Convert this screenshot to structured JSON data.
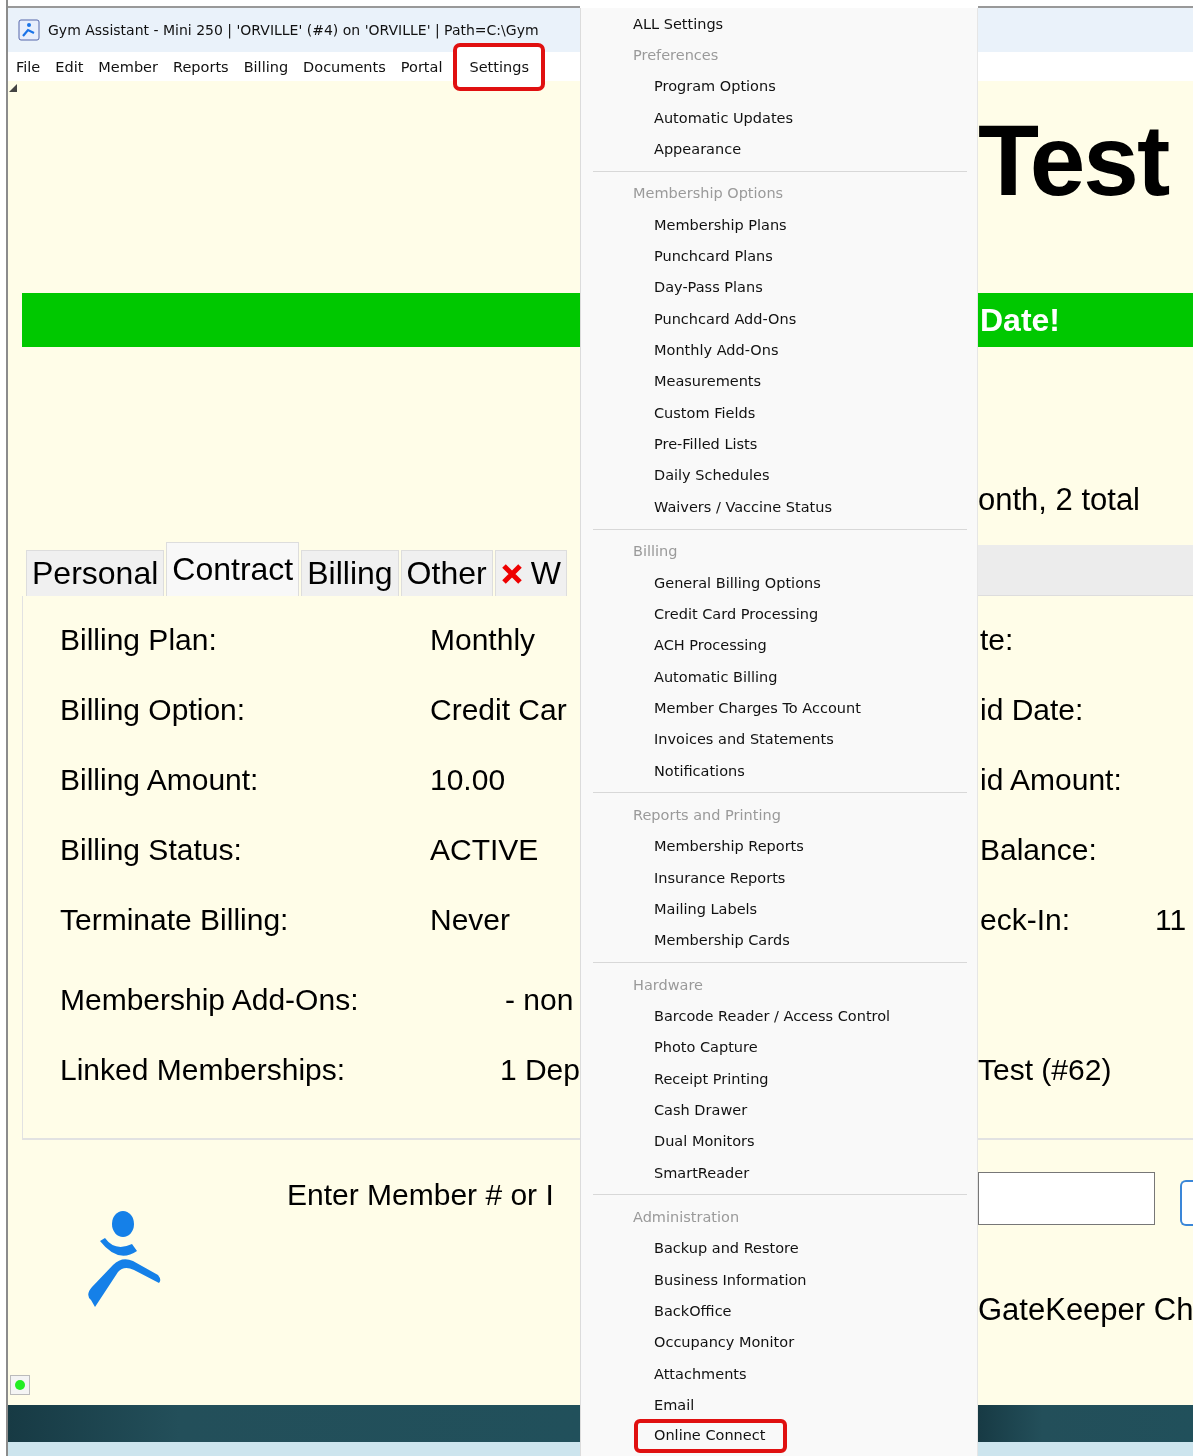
{
  "window": {
    "title": "Gym Assistant - Mini 250 | 'ORVILLE' (#4) on 'ORVILLE' | Path=C:\\Gym"
  },
  "menubar": [
    {
      "label": "File",
      "highlighted": false
    },
    {
      "label": "Edit",
      "highlighted": false
    },
    {
      "label": "Member",
      "highlighted": false
    },
    {
      "label": "Reports",
      "highlighted": false
    },
    {
      "label": "Billing",
      "highlighted": false
    },
    {
      "label": "Documents",
      "highlighted": false
    },
    {
      "label": "Portal",
      "highlighted": false
    },
    {
      "label": "Settings",
      "highlighted": true
    }
  ],
  "header": {
    "name": "Test",
    "banner": "Date!",
    "visits": "onth, 2 total"
  },
  "tabs": [
    {
      "label": "Personal",
      "selected": false,
      "kind": "plain"
    },
    {
      "label": "Contract",
      "selected": true,
      "kind": "plain"
    },
    {
      "label": "Billing",
      "selected": false,
      "kind": "plain"
    },
    {
      "label": "Other",
      "selected": false,
      "kind": "plain"
    },
    {
      "label": "W",
      "selected": false,
      "kind": "flagged"
    }
  ],
  "contract": {
    "rows": [
      {
        "kind": "field",
        "label": "Billing Plan:",
        "value": "Monthly",
        "right_label": "te:"
      },
      {
        "kind": "field",
        "label": "Billing Option:",
        "value": "Credit Car",
        "right_label": "id Date:"
      },
      {
        "kind": "field",
        "label": "Billing Amount:",
        "value": "10.00",
        "right_label": "id Amount:"
      },
      {
        "kind": "field",
        "label": "Billing Status:",
        "value": "ACTIVE",
        "right_label": "Balance:"
      },
      {
        "kind": "field",
        "label": "Terminate Billing:",
        "value": "Never",
        "right_label": "eck-In:",
        "right_value": "11"
      },
      {
        "kind": "wide",
        "label": "Membership Add-Ons:",
        "value": "- non"
      },
      {
        "kind": "wide",
        "label": "Linked Memberships:",
        "value": "1 Dep",
        "right_value": "Test (#62)"
      }
    ]
  },
  "lookup": {
    "prompt": "Enter Member # or I",
    "gatekeeper": "GateKeeper Ch"
  },
  "settings_menu": {
    "entries": [
      {
        "kind": "top",
        "label": "ALL Settings",
        "highlighted": false
      },
      {
        "kind": "header",
        "label": "Preferences"
      },
      {
        "kind": "item",
        "label": "Program Options",
        "highlighted": false
      },
      {
        "kind": "item",
        "label": "Automatic Updates",
        "highlighted": false
      },
      {
        "kind": "item",
        "label": "Appearance",
        "highlighted": false
      },
      {
        "kind": "separator"
      },
      {
        "kind": "header",
        "label": "Membership Options"
      },
      {
        "kind": "item",
        "label": "Membership Plans",
        "highlighted": false
      },
      {
        "kind": "item",
        "label": "Punchcard Plans",
        "highlighted": false
      },
      {
        "kind": "item",
        "label": "Day-Pass Plans",
        "highlighted": false
      },
      {
        "kind": "item",
        "label": "Punchcard Add-Ons",
        "highlighted": false
      },
      {
        "kind": "item",
        "label": "Monthly Add-Ons",
        "highlighted": false
      },
      {
        "kind": "item",
        "label": "Measurements",
        "highlighted": false
      },
      {
        "kind": "item",
        "label": "Custom Fields",
        "highlighted": false
      },
      {
        "kind": "item",
        "label": "Pre-Filled Lists",
        "highlighted": false
      },
      {
        "kind": "item",
        "label": "Daily Schedules",
        "highlighted": false
      },
      {
        "kind": "item",
        "label": "Waivers / Vaccine Status",
        "highlighted": false
      },
      {
        "kind": "separator"
      },
      {
        "kind": "header",
        "label": "Billing"
      },
      {
        "kind": "item",
        "label": "General Billing Options",
        "highlighted": false
      },
      {
        "kind": "item",
        "label": "Credit Card Processing",
        "highlighted": false
      },
      {
        "kind": "item",
        "label": "ACH Processing",
        "highlighted": false
      },
      {
        "kind": "item",
        "label": "Automatic Billing",
        "highlighted": false
      },
      {
        "kind": "item",
        "label": "Member Charges To Account",
        "highlighted": false
      },
      {
        "kind": "item",
        "label": "Invoices and Statements",
        "highlighted": false
      },
      {
        "kind": "item",
        "label": "Notifications",
        "highlighted": false
      },
      {
        "kind": "separator"
      },
      {
        "kind": "header",
        "label": "Reports and Printing"
      },
      {
        "kind": "item",
        "label": "Membership Reports",
        "highlighted": false
      },
      {
        "kind": "item",
        "label": "Insurance Reports",
        "highlighted": false
      },
      {
        "kind": "item",
        "label": "Mailing Labels",
        "highlighted": false
      },
      {
        "kind": "item",
        "label": "Membership Cards",
        "highlighted": false
      },
      {
        "kind": "separator"
      },
      {
        "kind": "header",
        "label": "Hardware"
      },
      {
        "kind": "item",
        "label": "Barcode Reader / Access Control",
        "highlighted": false
      },
      {
        "kind": "item",
        "label": "Photo Capture",
        "highlighted": false
      },
      {
        "kind": "item",
        "label": "Receipt Printing",
        "highlighted": false
      },
      {
        "kind": "item",
        "label": "Cash Drawer",
        "highlighted": false
      },
      {
        "kind": "item",
        "label": "Dual Monitors",
        "highlighted": false
      },
      {
        "kind": "item",
        "label": "SmartReader",
        "highlighted": false
      },
      {
        "kind": "separator"
      },
      {
        "kind": "header",
        "label": "Administration"
      },
      {
        "kind": "item",
        "label": "Backup and Restore",
        "highlighted": false
      },
      {
        "kind": "item",
        "label": "Business Information",
        "highlighted": false
      },
      {
        "kind": "item",
        "label": "BackOffice",
        "highlighted": false
      },
      {
        "kind": "item",
        "label": "Occupancy Monitor",
        "highlighted": false
      },
      {
        "kind": "item",
        "label": "Attachments",
        "highlighted": false
      },
      {
        "kind": "item",
        "label": "Email",
        "highlighted": false
      },
      {
        "kind": "item",
        "label": "Online Connect",
        "highlighted": true
      }
    ]
  }
}
